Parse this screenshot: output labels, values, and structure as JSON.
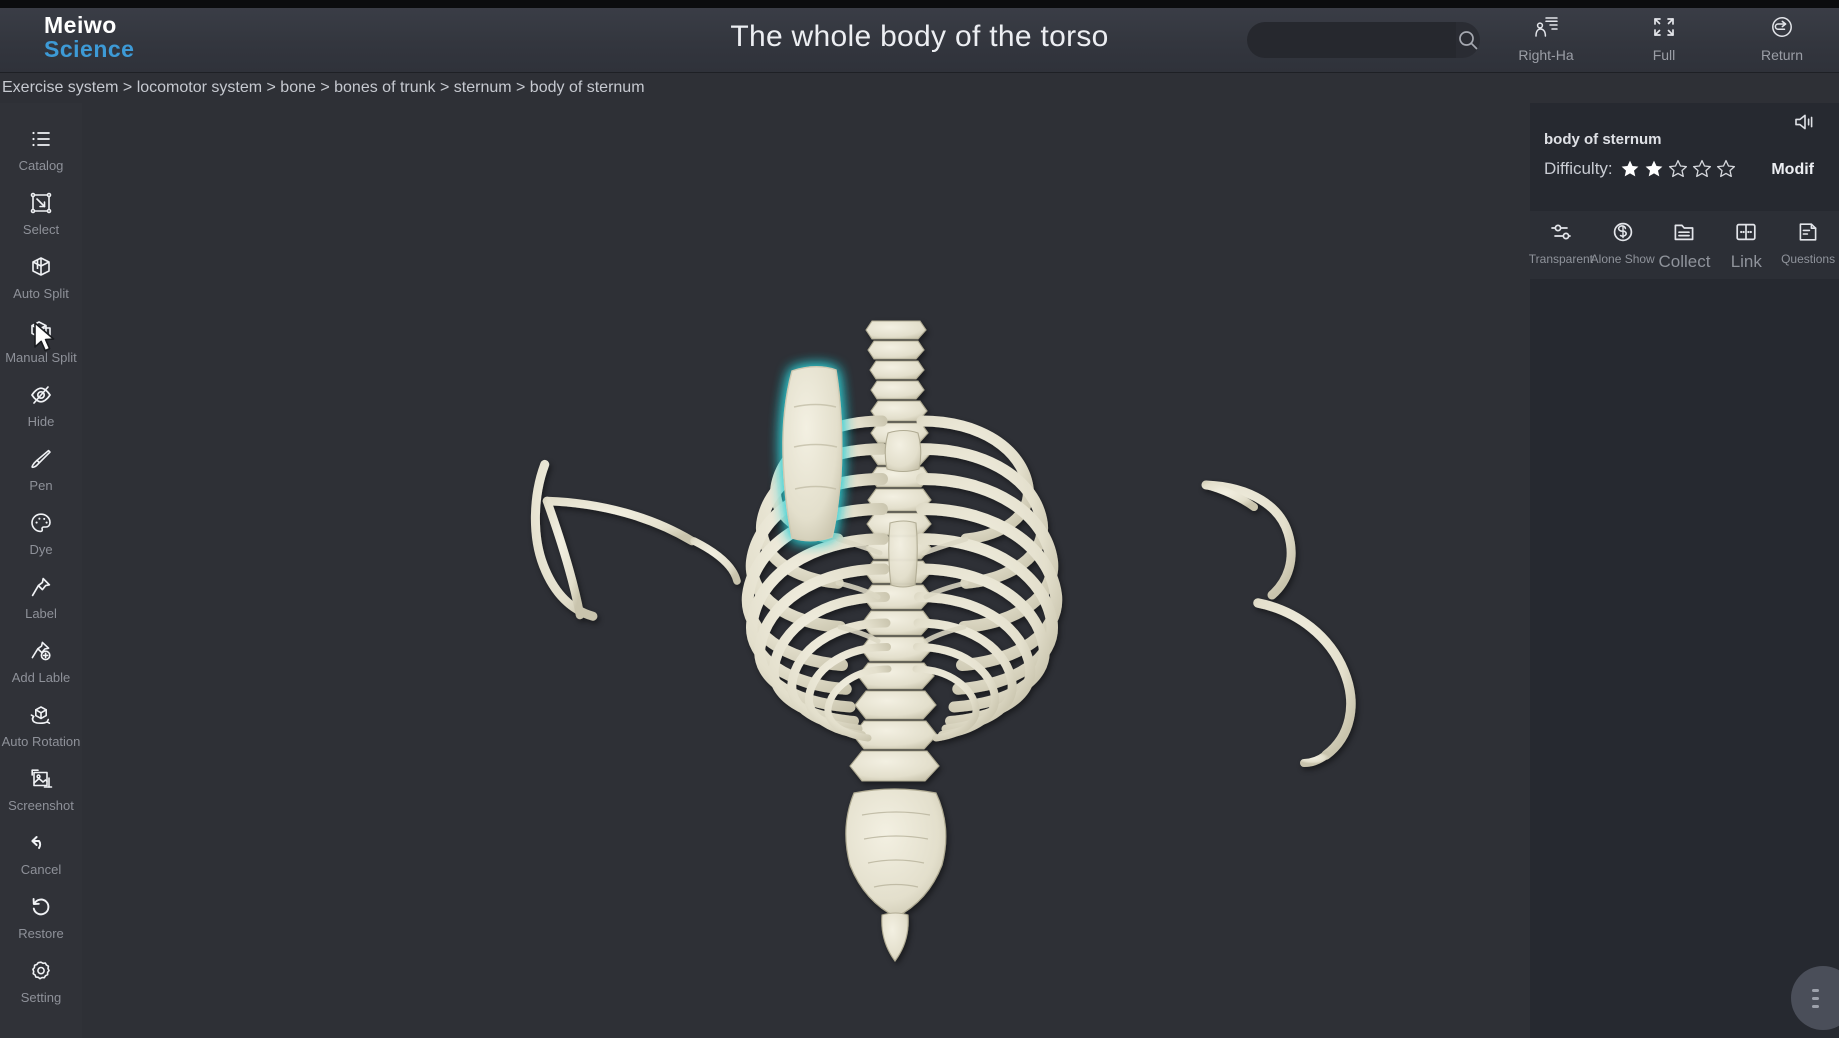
{
  "app": {
    "logo_top": "Meiwo",
    "logo_bottom": "Science",
    "title": "The whole body of the torso",
    "accent_color": "#3d9ad6",
    "background_color": "#2e3036",
    "panel_color": "#262930",
    "highlight_color": "#2fd0d6"
  },
  "search": {
    "value": "",
    "placeholder": "",
    "icon": "search-icon"
  },
  "header_tools": [
    {
      "label": "Right-Ha",
      "icon": "right-hand-icon"
    },
    {
      "label": "Full",
      "icon": "fullscreen-icon"
    },
    {
      "label": "Return",
      "icon": "return-icon"
    }
  ],
  "breadcrumb": {
    "text": "Exercise system > locomotor system > bone > bones of trunk > sternum > body of sternum",
    "items": [
      "Exercise system",
      "locomotor system",
      "bone",
      "bones of trunk",
      "sternum",
      "body of sternum"
    ],
    "separator": ">"
  },
  "sidebar": {
    "items": [
      {
        "label": "Catalog",
        "icon": "list-icon"
      },
      {
        "label": "Select",
        "icon": "select-box-icon"
      },
      {
        "label": "Auto Split",
        "icon": "cube-split-icon"
      },
      {
        "label": "Manual Split",
        "icon": "cube-manual-split-icon"
      },
      {
        "label": "Hide",
        "icon": "eye-off-icon"
      },
      {
        "label": "Pen",
        "icon": "brush-icon"
      },
      {
        "label": "Dye",
        "icon": "palette-icon"
      },
      {
        "label": "Label",
        "icon": "pin-icon"
      },
      {
        "label": "Add Lable",
        "icon": "pin-add-icon"
      },
      {
        "label": "Auto Rotation",
        "icon": "rotate-cube-icon"
      },
      {
        "label": "Screenshot",
        "icon": "image-capture-icon"
      },
      {
        "label": "Cancel",
        "icon": "undo-arrow-icon"
      },
      {
        "label": "Restore",
        "icon": "restore-icon"
      },
      {
        "label": "Setting",
        "icon": "gear-icon"
      }
    ]
  },
  "right_panel": {
    "structure_name": "body of sternum",
    "speaker_icon": "speaker-icon",
    "difficulty_label": "Difficulty:",
    "difficulty_value": 2,
    "difficulty_max": 5,
    "modify_label": "Modif",
    "actions": [
      {
        "label": "Transparent",
        "icon": "sliders-icon",
        "size": "sm"
      },
      {
        "label": "Alone Show",
        "icon": "solo-icon",
        "size": "sm"
      },
      {
        "label": "Collect",
        "icon": "folder-icon",
        "size": "lg"
      },
      {
        "label": "Link",
        "icon": "grid-link-icon",
        "size": "lg"
      },
      {
        "label": "Questions",
        "icon": "document-icon",
        "size": "sm"
      }
    ]
  },
  "viewport": {
    "model": "torso skeleton",
    "selected_part": "body of sternum",
    "fab_icon": "more-dots-icon"
  }
}
